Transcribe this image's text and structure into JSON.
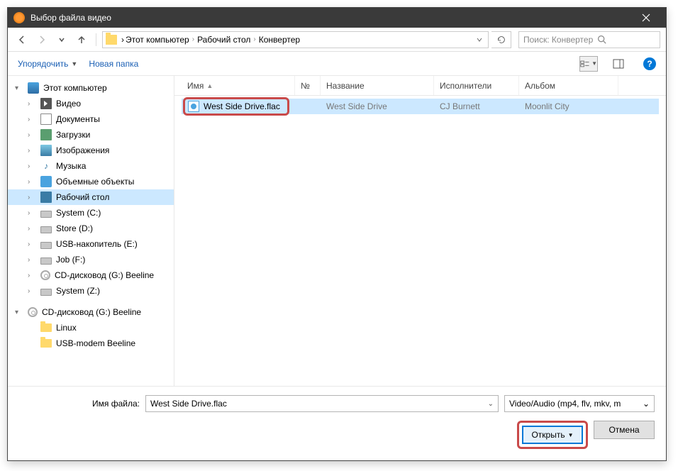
{
  "window": {
    "title": "Выбор файла видео"
  },
  "breadcrumb": {
    "root": "Этот компьютер",
    "items": [
      "Рабочий стол",
      "Конвертер"
    ]
  },
  "search": {
    "placeholder": "Поиск: Конвертер"
  },
  "toolbar": {
    "organize": "Упорядочить",
    "newfolder": "Новая папка"
  },
  "tree": {
    "this_pc": "Этот компьютер",
    "items1": [
      {
        "label": "Видео",
        "icon": "video"
      },
      {
        "label": "Документы",
        "icon": "doc"
      },
      {
        "label": "Загрузки",
        "icon": "dl"
      },
      {
        "label": "Изображения",
        "icon": "img"
      },
      {
        "label": "Музыка",
        "icon": "music"
      },
      {
        "label": "Объемные объекты",
        "icon": "3d"
      },
      {
        "label": "Рабочий стол",
        "icon": "desktop",
        "selected": true
      },
      {
        "label": "System (C:)",
        "icon": "drive"
      },
      {
        "label": "Store (D:)",
        "icon": "drive"
      },
      {
        "label": "USB-накопитель (E:)",
        "icon": "drive"
      },
      {
        "label": "Job (F:)",
        "icon": "drive"
      },
      {
        "label": "CD-дисковод (G:) Beeline",
        "icon": "cd"
      },
      {
        "label": "System (Z:)",
        "icon": "drive"
      }
    ],
    "cd_group": "CD-дисковод (G:) Beeline",
    "items2": [
      {
        "label": "Linux",
        "icon": "folder"
      },
      {
        "label": "USB-modem Beeline",
        "icon": "folder"
      }
    ]
  },
  "columns": {
    "name": "Имя",
    "num": "№",
    "title": "Название",
    "artist": "Исполнители",
    "album": "Альбом"
  },
  "files": [
    {
      "name": "West Side Drive.flac",
      "num": "",
      "title": "West Side Drive",
      "artist": "CJ Burnett",
      "album": "Moonlit City",
      "selected": true,
      "highlighted": true
    }
  ],
  "footer": {
    "filename_label": "Имя файла:",
    "filename_value": "West Side Drive.flac",
    "filter": "Video/Audio (mp4, flv, mkv, m",
    "open": "Открыть",
    "cancel": "Отмена"
  }
}
